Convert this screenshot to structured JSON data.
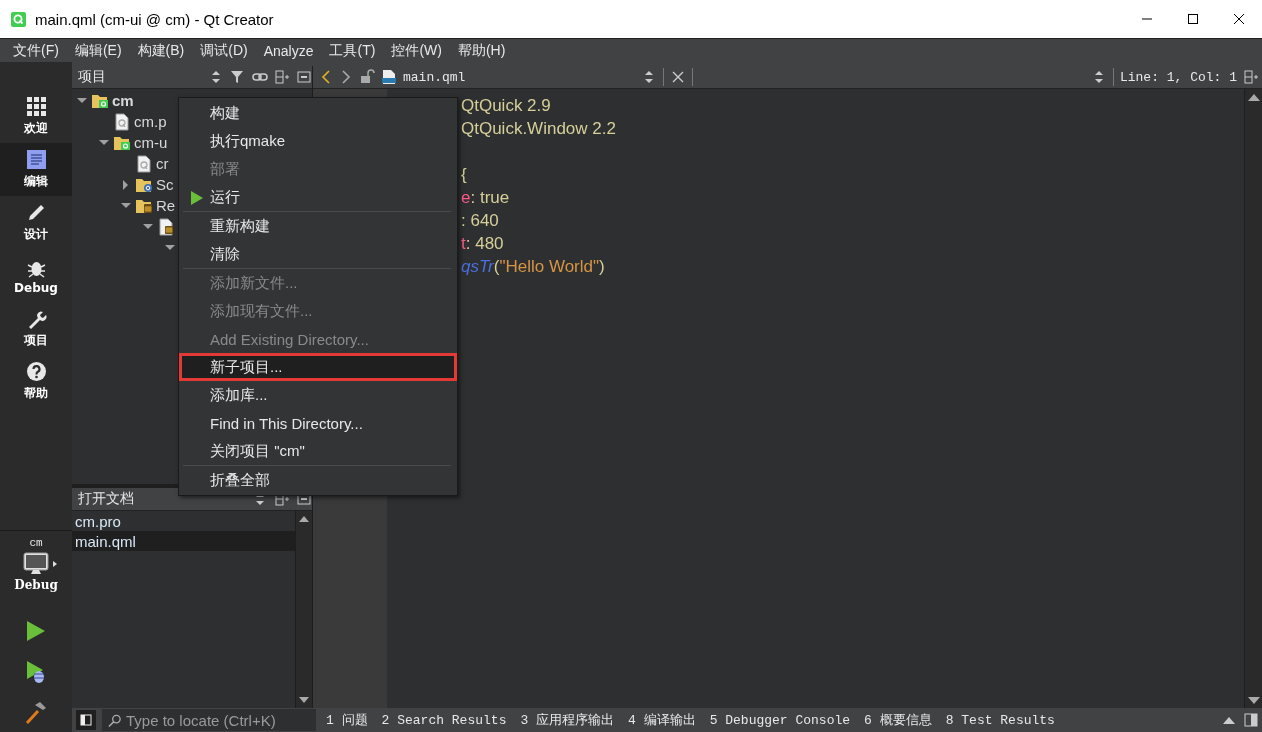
{
  "window": {
    "title": "main.qml (cm-ui @ cm) - Qt Creator"
  },
  "menubar": [
    "文件(F)",
    "编辑(E)",
    "构建(B)",
    "调试(D)",
    "Analyze",
    "工具(T)",
    "控件(W)",
    "帮助(H)"
  ],
  "modes": [
    {
      "label": "欢迎",
      "kind": "welcome",
      "selected": false
    },
    {
      "label": "编辑",
      "kind": "edit",
      "selected": true
    },
    {
      "label": "设计",
      "kind": "design",
      "selected": false
    },
    {
      "label": "Debug",
      "kind": "debug",
      "selected": false
    },
    {
      "label": "项目",
      "kind": "projects",
      "selected": false
    },
    {
      "label": "帮助",
      "kind": "help",
      "selected": false
    }
  ],
  "kit": {
    "project": "cm",
    "config": "Debug"
  },
  "project_panel": {
    "title": "项目",
    "tree": [
      {
        "label": "cm",
        "kind": "project",
        "expanded": true,
        "children": [
          {
            "label": "cm.p",
            "kind": "pro_file"
          },
          {
            "label": "cm-u",
            "kind": "project",
            "expanded": true,
            "children": [
              {
                "label": "cr",
                "kind": "pro_file"
              },
              {
                "label": "Sc",
                "kind": "sources",
                "expanded": false
              },
              {
                "label": "Re",
                "kind": "resources",
                "expanded": true,
                "children": [
                  {
                    "kind": "qrc",
                    "expanded": true,
                    "children": [
                      {
                        "expanded": true
                      }
                    ]
                  }
                ]
              }
            ]
          }
        ]
      }
    ]
  },
  "open_docs": {
    "title": "打开文档",
    "items": [
      {
        "label": "cm.pro",
        "selected": false
      },
      {
        "label": "main.qml",
        "selected": true
      }
    ]
  },
  "editor": {
    "file": "main.qml",
    "position": "Line: 1, Col: 1",
    "lines": [
      {
        "segments": [
          {
            "text": "QtQuick 2.9",
            "kind": "plain"
          }
        ]
      },
      {
        "segments": [
          {
            "text": "QtQuick.Window 2.2",
            "kind": "plain"
          }
        ]
      },
      {
        "blank": true
      },
      {
        "segments": [
          {
            "text": "{",
            "kind": "plain"
          }
        ]
      },
      {
        "segments": [
          {
            "text": "e",
            "kind": "property"
          },
          {
            "text": ": true",
            "kind": "plain"
          }
        ]
      },
      {
        "segments": [
          {
            "text": ": 640",
            "kind": "plain"
          }
        ]
      },
      {
        "segments": [
          {
            "text": "t",
            "kind": "property"
          },
          {
            "text": ": 480",
            "kind": "plain"
          }
        ]
      },
      {
        "segments": [
          {
            "text": "qsTr",
            "kind": "function"
          },
          {
            "text": "(",
            "kind": "plain"
          },
          {
            "text": "\"Hello World\"",
            "kind": "string"
          },
          {
            "text": ")",
            "kind": "plain"
          }
        ]
      }
    ]
  },
  "context_menu": [
    {
      "kind": "action",
      "label": "构建",
      "disabled": false,
      "selected": false
    },
    {
      "kind": "action",
      "label": "执行qmake",
      "disabled": false,
      "selected": false
    },
    {
      "kind": "action",
      "label": "部署",
      "disabled": true,
      "selected": false
    },
    {
      "kind": "run_action",
      "label": "运行",
      "disabled": false,
      "selected": false
    },
    {
      "kind": "separator"
    },
    {
      "kind": "action",
      "label": "重新构建",
      "disabled": false,
      "selected": false
    },
    {
      "kind": "action",
      "label": "清除",
      "disabled": false,
      "selected": false
    },
    {
      "kind": "separator"
    },
    {
      "kind": "action",
      "label": "添加新文件...",
      "disabled": true,
      "selected": false
    },
    {
      "kind": "action",
      "label": "添加现有文件...",
      "disabled": true,
      "selected": false
    },
    {
      "kind": "action",
      "label": "Add Existing Directory...",
      "disabled": true,
      "selected": false
    },
    {
      "kind": "action",
      "label": "新子项目...",
      "disabled": false,
      "selected": true
    },
    {
      "kind": "action",
      "label": "添加库...",
      "disabled": false,
      "selected": false
    },
    {
      "kind": "action",
      "label": "Find in This Directory...",
      "disabled": false,
      "selected": false
    },
    {
      "kind": "action",
      "label": "关闭项目 \"cm\"",
      "disabled": false,
      "selected": false
    },
    {
      "kind": "separator"
    },
    {
      "kind": "action",
      "label": "折叠全部",
      "disabled": false,
      "selected": false
    }
  ],
  "locator": {
    "placeholder": "Type to locate (Ctrl+K)"
  },
  "output_tabs": [
    "1 问题",
    "2 Search Results",
    "3 应用程序输出",
    "4 编译输出",
    "5 Debugger Console",
    "6 概要信息",
    "8 Test Results"
  ]
}
